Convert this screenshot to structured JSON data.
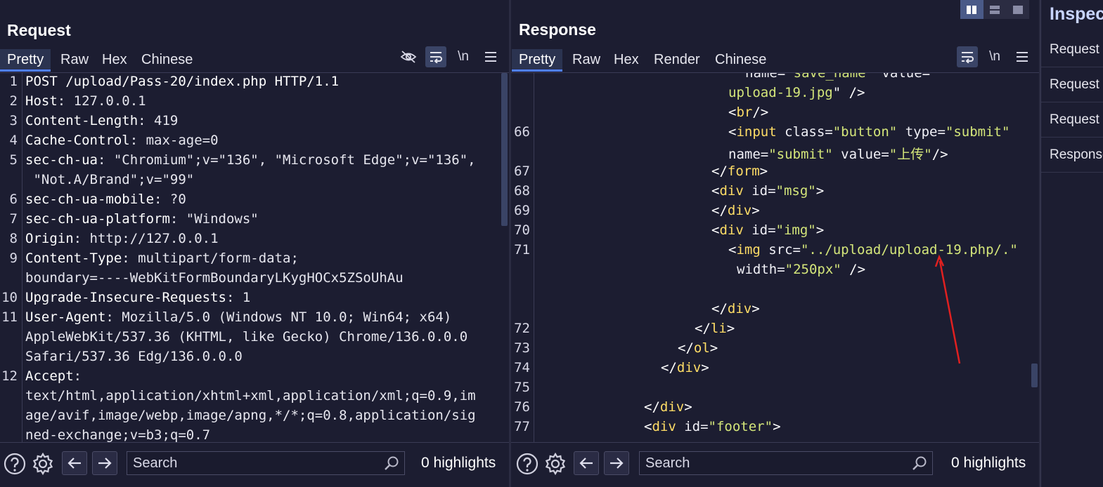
{
  "request": {
    "title": "Request",
    "tabs": [
      "Pretty",
      "Raw",
      "Hex",
      "Chinese"
    ],
    "newline_label": "\\n",
    "lines": [
      {
        "n": "1",
        "name": "POST /upload/Pass-20/index.php HTTP/1.1",
        "value": ""
      },
      {
        "n": "2",
        "name": "Host",
        "value": ": 127.0.0.1"
      },
      {
        "n": "3",
        "name": "Content-Length",
        "value": ": 419"
      },
      {
        "n": "4",
        "name": "Cache-Control",
        "value": ": max-age=0"
      },
      {
        "n": "5",
        "name": "sec-ch-ua",
        "value": ": \"Chromium\";v=\"136\", \"Microsoft Edge\";v=\"136\","
      },
      {
        "n": "",
        "name": "",
        "value": " \"Not.A/Brand\";v=\"99\""
      },
      {
        "n": "6",
        "name": "sec-ch-ua-mobile",
        "value": ": ?0"
      },
      {
        "n": "7",
        "name": "sec-ch-ua-platform",
        "value": ": \"Windows\""
      },
      {
        "n": "8",
        "name": "Origin",
        "value": ": http://127.0.0.1"
      },
      {
        "n": "9",
        "name": "Content-Type",
        "value": ": multipart/form-data;"
      },
      {
        "n": "",
        "name": "",
        "value": "boundary=----WebKitFormBoundaryLKygHOCx5ZSoUhAu"
      },
      {
        "n": "10",
        "name": "Upgrade-Insecure-Requests",
        "value": ": 1"
      },
      {
        "n": "11",
        "name": "User-Agent",
        "value": ": Mozilla/5.0 (Windows NT 10.0; Win64; x64)"
      },
      {
        "n": "",
        "name": "",
        "value": "AppleWebKit/537.36 (KHTML, like Gecko) Chrome/136.0.0.0"
      },
      {
        "n": "",
        "name": "",
        "value": "Safari/537.36 Edg/136.0.0.0"
      },
      {
        "n": "12",
        "name": "Accept",
        "value": ":"
      },
      {
        "n": "",
        "name": "",
        "value": "text/html,application/xhtml+xml,application/xml;q=0.9,im"
      },
      {
        "n": "",
        "name": "",
        "value": "age/avif,image/webp,image/apng,*/*;q=0.8,application/sig"
      },
      {
        "n": "",
        "name": "",
        "value": "ned-exchange;v=b3;q=0.7"
      }
    ],
    "search_placeholder": "Search",
    "highlights": "0 highlights"
  },
  "response": {
    "title": "Response",
    "tabs": [
      "Pretty",
      "Raw",
      "Hex",
      "Render",
      "Chinese"
    ],
    "newline_label": "\\n",
    "lines": [
      {
        "n": "",
        "indent": 12,
        "parts": [
          [
            "attr",
            "name="
          ],
          [
            "str",
            "\"save_name\""
          ],
          [
            "attr",
            " value="
          ]
        ]
      },
      {
        "n": "",
        "indent": 11,
        "parts": [
          [
            "str",
            "upload-19.jpg"
          ],
          [
            "punc",
            "\" />"
          ]
        ]
      },
      {
        "n": "",
        "indent": 11,
        "parts": [
          [
            "punc",
            "<"
          ],
          [
            "tag",
            "br"
          ],
          [
            "punc",
            "/>"
          ]
        ]
      },
      {
        "n": "66",
        "indent": 11,
        "parts": [
          [
            "punc",
            "<"
          ],
          [
            "tag",
            "input"
          ],
          [
            "attr",
            " class="
          ],
          [
            "str",
            "\"button\""
          ],
          [
            "attr",
            " type="
          ],
          [
            "str",
            "\"submit\""
          ]
        ]
      },
      {
        "n": "",
        "indent": 11,
        "parts": [
          [
            "attr",
            "name="
          ],
          [
            "str",
            "\"submit\""
          ],
          [
            "attr",
            " value="
          ],
          [
            "str",
            "\"上传\""
          ],
          [
            "punc",
            "/>"
          ]
        ]
      },
      {
        "n": "67",
        "indent": 10,
        "parts": [
          [
            "punc",
            "</"
          ],
          [
            "tag",
            "form"
          ],
          [
            "punc",
            ">"
          ]
        ]
      },
      {
        "n": "68",
        "indent": 10,
        "parts": [
          [
            "punc",
            "<"
          ],
          [
            "tag",
            "div"
          ],
          [
            "attr",
            " id="
          ],
          [
            "str",
            "\"msg\""
          ],
          [
            "punc",
            ">"
          ]
        ]
      },
      {
        "n": "69",
        "indent": 10,
        "parts": [
          [
            "punc",
            "</"
          ],
          [
            "tag",
            "div"
          ],
          [
            "punc",
            ">"
          ]
        ]
      },
      {
        "n": "70",
        "indent": 10,
        "parts": [
          [
            "punc",
            "<"
          ],
          [
            "tag",
            "div"
          ],
          [
            "attr",
            " id="
          ],
          [
            "str",
            "\"img\""
          ],
          [
            "punc",
            ">"
          ]
        ]
      },
      {
        "n": "71",
        "indent": 11,
        "parts": [
          [
            "punc",
            "<"
          ],
          [
            "tag",
            "img"
          ],
          [
            "attr",
            " src="
          ],
          [
            "str",
            "\"../upload/upload-19.php/.\""
          ]
        ]
      },
      {
        "n": "",
        "indent": 11.5,
        "parts": [
          [
            "attr",
            "width="
          ],
          [
            "str",
            "\"250px\""
          ],
          [
            "punc",
            " />"
          ]
        ]
      },
      {
        "n": "",
        "indent": 0,
        "parts": []
      },
      {
        "n": "",
        "indent": 10,
        "parts": [
          [
            "punc",
            "</"
          ],
          [
            "tag",
            "div"
          ],
          [
            "punc",
            ">"
          ]
        ]
      },
      {
        "n": "72",
        "indent": 9,
        "parts": [
          [
            "punc",
            "</"
          ],
          [
            "tag",
            "li"
          ],
          [
            "punc",
            ">"
          ]
        ]
      },
      {
        "n": "73",
        "indent": 8,
        "parts": [
          [
            "punc",
            "</"
          ],
          [
            "tag",
            "ol"
          ],
          [
            "punc",
            ">"
          ]
        ]
      },
      {
        "n": "74",
        "indent": 7,
        "parts": [
          [
            "punc",
            "</"
          ],
          [
            "tag",
            "div"
          ],
          [
            "punc",
            ">"
          ]
        ]
      },
      {
        "n": "75",
        "indent": 0,
        "parts": []
      },
      {
        "n": "76",
        "indent": 6,
        "parts": [
          [
            "punc",
            "</"
          ],
          [
            "tag",
            "div"
          ],
          [
            "punc",
            ">"
          ]
        ]
      },
      {
        "n": "77",
        "indent": 6,
        "parts": [
          [
            "punc",
            "<"
          ],
          [
            "tag",
            "div"
          ],
          [
            "attr",
            " id="
          ],
          [
            "str",
            "\"footer\""
          ],
          [
            "punc",
            ">"
          ]
        ]
      }
    ],
    "search_placeholder": "Search",
    "highlights": "0 highlights"
  },
  "inspector": {
    "title": "Inspector",
    "items": [
      "Request attributes",
      "Request query parameters",
      "Request body parameters",
      "Response headers"
    ]
  },
  "colors": {
    "accent": "#4f7fff",
    "annotation_arrow": "#e02020",
    "tag": "#ffdd66",
    "string": "#d4e67a"
  }
}
